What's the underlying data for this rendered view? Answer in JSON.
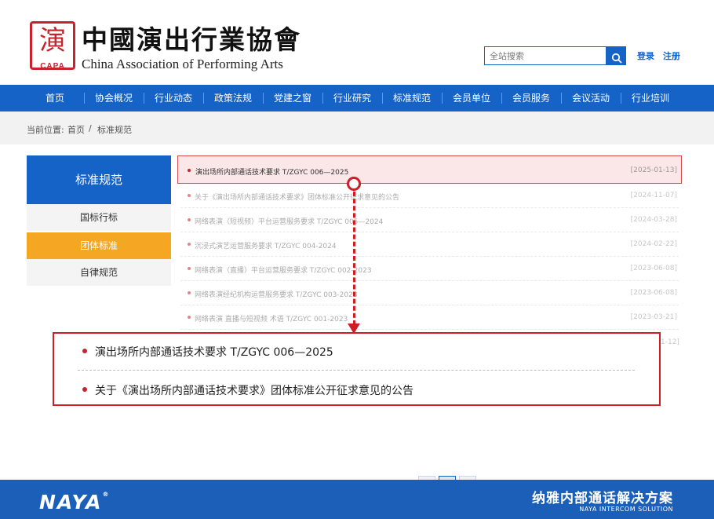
{
  "header": {
    "seal_glyph": "演",
    "seal_abbr": "CAPA",
    "title_cn": "中國演出行業協會",
    "title_en": "China Association of Performing Arts",
    "search_placeholder": "全站搜索",
    "login": "登录",
    "register": "注册"
  },
  "nav": [
    "首页",
    "协会概况",
    "行业动态",
    "政策法规",
    "党建之窗",
    "行业研究",
    "标准规范",
    "会员单位",
    "会员服务",
    "会议活动",
    "行业培训"
  ],
  "breadcrumb": {
    "prefix": "当前位置:",
    "home": "首页",
    "sep": "/",
    "current": "标准规范"
  },
  "sidebar": {
    "heading": "标准规范",
    "items": [
      "国标行标",
      "团体标准",
      "自律规范"
    ],
    "active_index": 1
  },
  "list": [
    {
      "title": "演出场所内部通话技术要求 T/ZGYC 006—2025",
      "date": "[2025-01-13]"
    },
    {
      "title": "关于《演出场所内部通话技术要求》团体标准公开征求意见的公告",
      "date": "[2024-11-07]"
    },
    {
      "title": "网络表演（短视频）平台运营服务要求 T/ZGYC 005—2024",
      "date": "[2024-03-28]"
    },
    {
      "title": "沉浸式演艺运营服务要求 T/ZGYC 004-2024",
      "date": "[2024-02-22]"
    },
    {
      "title": "网络表演（直播）平台运营服务要求 T/ZGYC 002-2023",
      "date": "[2023-06-08]"
    },
    {
      "title": "网络表演经纪机构运营服务要求 T/ZGYC 003-2023",
      "date": "[2023-06-08]"
    },
    {
      "title": "网络表演 直播与短视频 术语 T/ZGYC 001-2023",
      "date": "[2023-03-21]"
    }
  ],
  "peek_date": "1-12]",
  "zoom": {
    "row1": "演出场所内部通话技术要求 T/ZGYC 006—2025",
    "row2": "关于《演出场所内部通话技术要求》团体标准公开征求意见的公告"
  },
  "footer": {
    "logo": "NAYA",
    "logo_mark": "®",
    "slogan_cn": "纳雅内部通话解决方案",
    "slogan_en": "NAYA INTERCOM SOLUTION"
  },
  "colors": {
    "primary_blue": "#1563c6",
    "accent_orange": "#f5a623",
    "highlight_red": "#d21c24"
  },
  "icons": {
    "search_button": "search-icon"
  }
}
